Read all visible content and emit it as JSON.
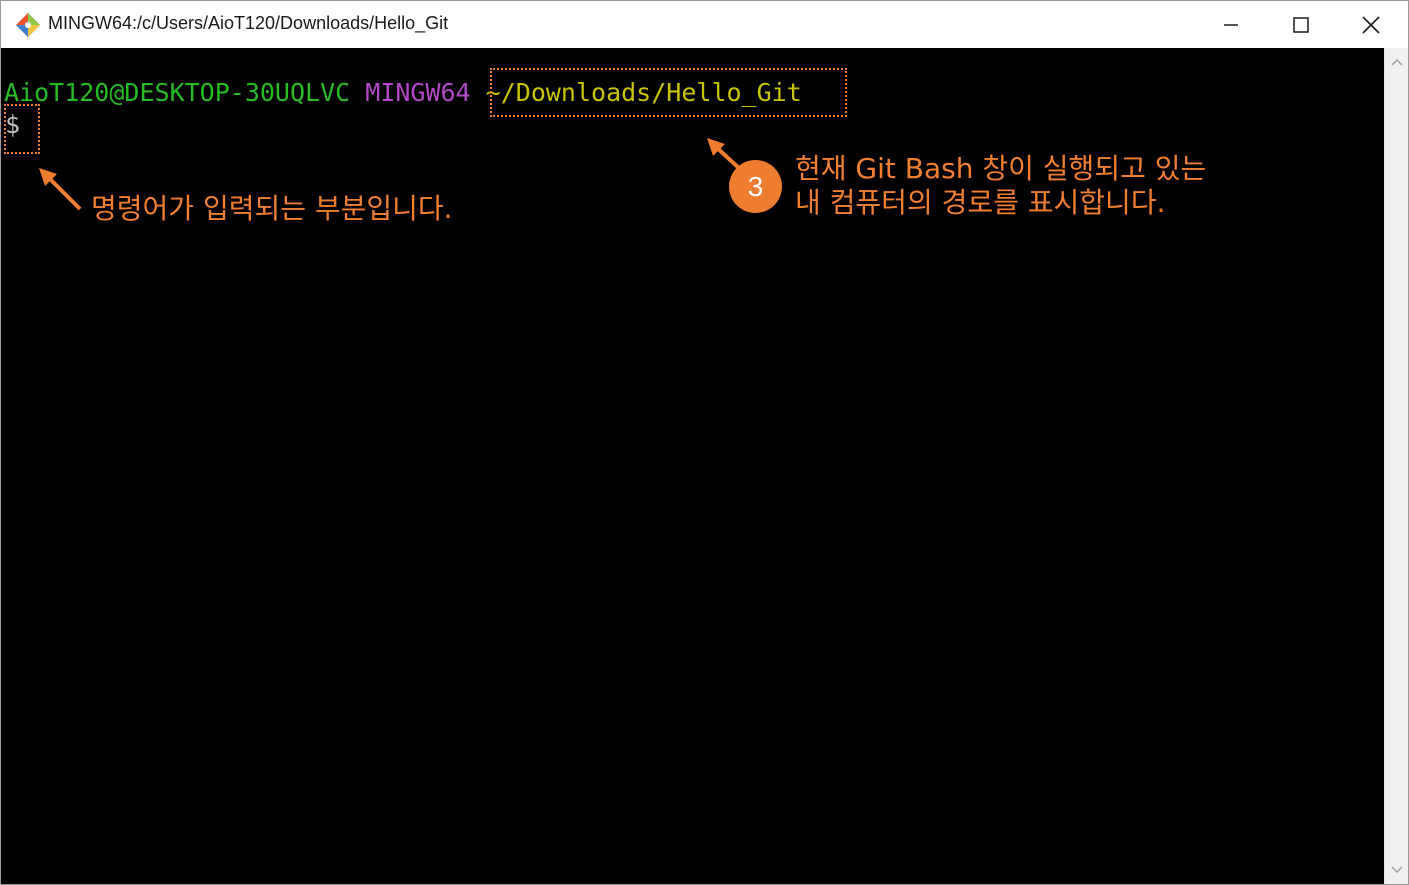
{
  "window": {
    "title": "MINGW64:/c/Users/AioT120/Downloads/Hello_Git"
  },
  "terminal": {
    "user_host": "AioT120@DESKTOP-30UQLVC",
    "shell": "MINGW64",
    "cwd": "~/Downloads/Hello_Git",
    "prompt_symbol": "$"
  },
  "annotations": {
    "command_note": "명령어가 입력되는 부분입니다.",
    "step_number": "3",
    "path_note_line1": "현재 Git Bash 창이 실행되고 있는",
    "path_note_line2": "내 컴퓨터의 경로를 표시합니다."
  },
  "colors": {
    "user_host": "#25bc24",
    "shell": "#b148c6",
    "cwd": "#c7c400",
    "annotation": "#ef7d2f",
    "terminal_bg": "#000000"
  },
  "icons": {
    "app": "git-logo-icon",
    "minimize": "minimize-icon",
    "maximize": "maximize-icon",
    "close": "close-icon",
    "scroll_up": "chevron-up-icon",
    "scroll_down": "chevron-down-icon"
  }
}
